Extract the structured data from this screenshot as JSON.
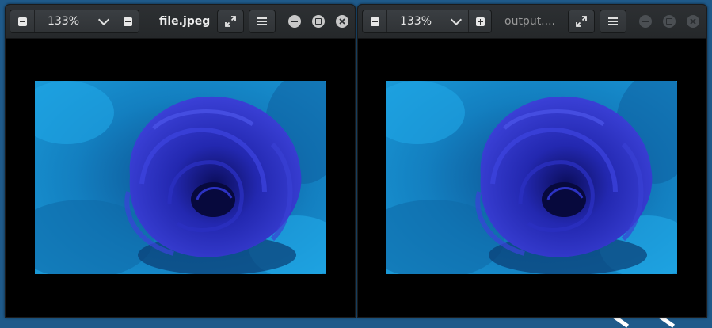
{
  "windows": [
    {
      "title": "file.jpeg",
      "active": true,
      "zoom": "133%",
      "image": {
        "alt": "blue-rose-photo"
      }
    },
    {
      "title": "output....",
      "active": false,
      "zoom": "133%",
      "image": {
        "alt": "blue-rose-photo"
      }
    }
  ],
  "colors": {
    "titlebar": "#2b2e31",
    "title_active": "#eeeeee",
    "title_inactive": "#9a9a9a",
    "canvas": "#000000",
    "rose": "#2a2fc4",
    "background_blue": "#1a8fcf"
  },
  "icons": [
    "zoom-out-icon",
    "chevron-down-icon",
    "zoom-in-icon",
    "fullscreen-icon",
    "menu-icon",
    "minimize-icon",
    "maximize-icon",
    "close-icon"
  ]
}
